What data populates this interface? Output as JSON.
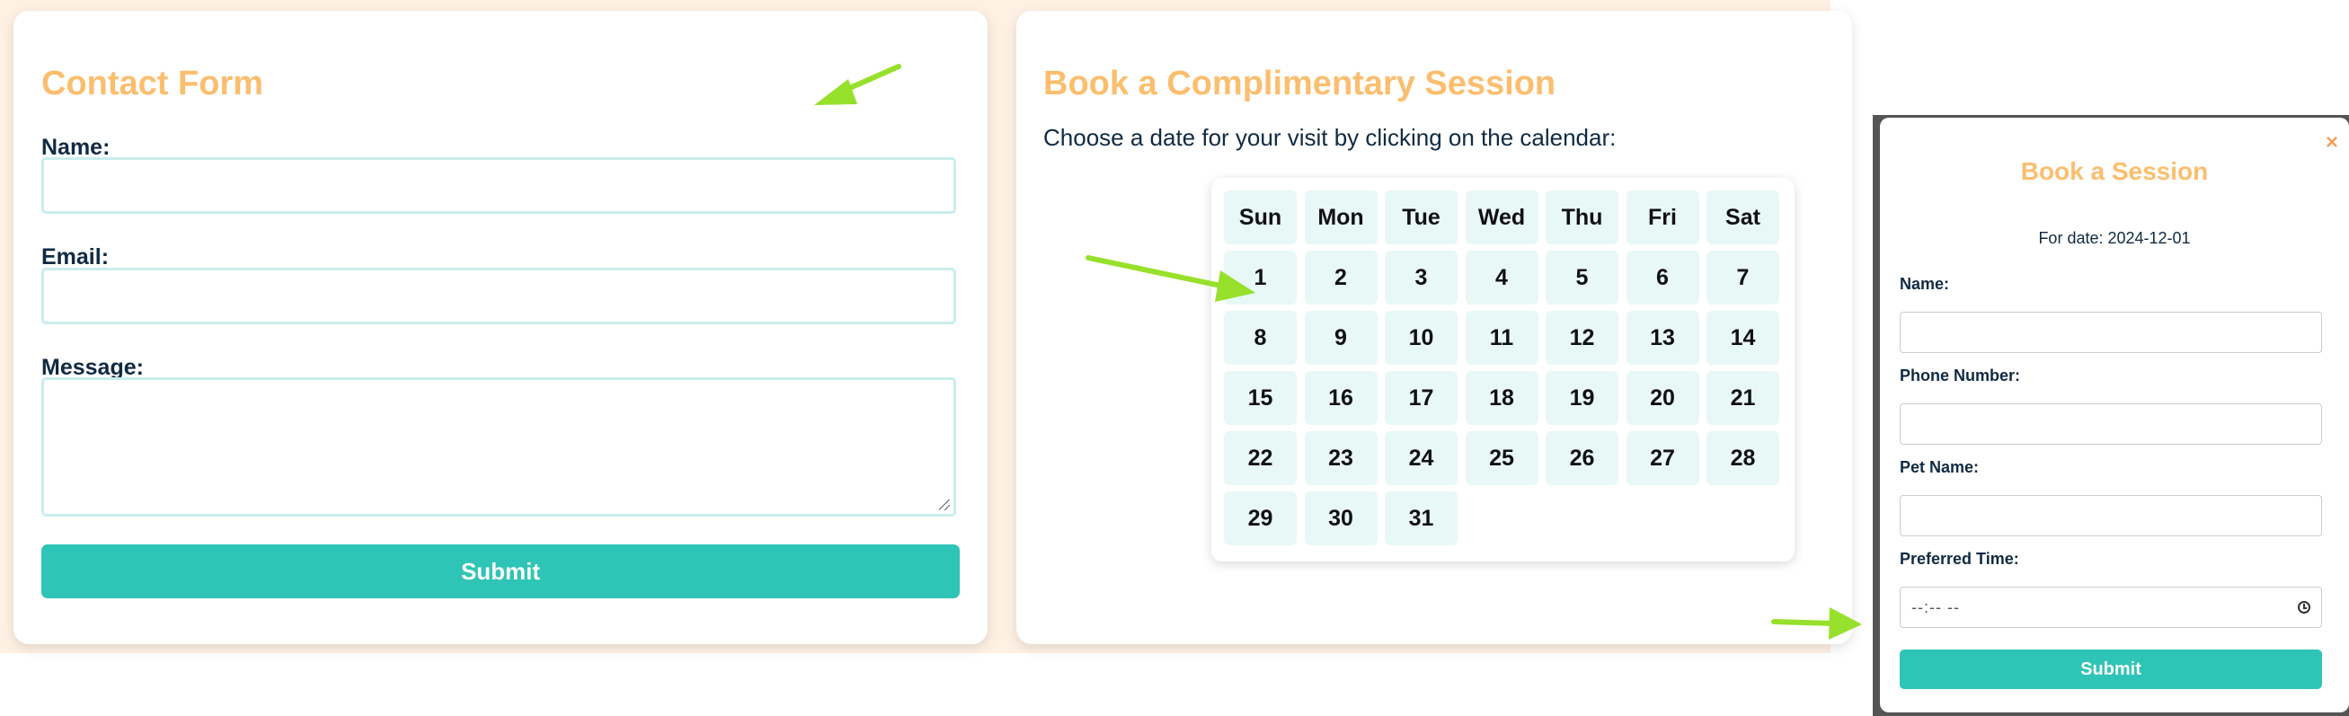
{
  "contact_form": {
    "title": "Contact Form",
    "name_label": "Name:",
    "email_label": "Email:",
    "message_label": "Message:",
    "submit_label": "Submit"
  },
  "booking": {
    "title": "Book a Complimentary Session",
    "instruction": "Choose a date for your visit by clicking on the calendar:",
    "calendar": {
      "weekdays": [
        "Sun",
        "Mon",
        "Tue",
        "Wed",
        "Thu",
        "Fri",
        "Sat"
      ],
      "days": [
        "1",
        "2",
        "3",
        "4",
        "5",
        "6",
        "7",
        "8",
        "9",
        "10",
        "11",
        "12",
        "13",
        "14",
        "15",
        "16",
        "17",
        "18",
        "19",
        "20",
        "21",
        "22",
        "23",
        "24",
        "25",
        "26",
        "27",
        "28",
        "29",
        "30",
        "31"
      ]
    }
  },
  "modal": {
    "close_icon": "×",
    "title": "Book a Session",
    "date_text": "For date: 2024-12-01",
    "name_label": "Name:",
    "phone_label": "Phone Number:",
    "pet_label": "Pet Name:",
    "time_label": "Preferred Time:",
    "time_placeholder": "--:-- --",
    "submit_label": "Submit"
  },
  "colors": {
    "accent_orange": "#fbbe6e",
    "teal": "#2ec4b6",
    "cell_bg": "#e8f8f6",
    "annotation_arrow": "#97e02b"
  },
  "icons": [
    "close-icon",
    "clock-icon",
    "arrow-annotation"
  ]
}
